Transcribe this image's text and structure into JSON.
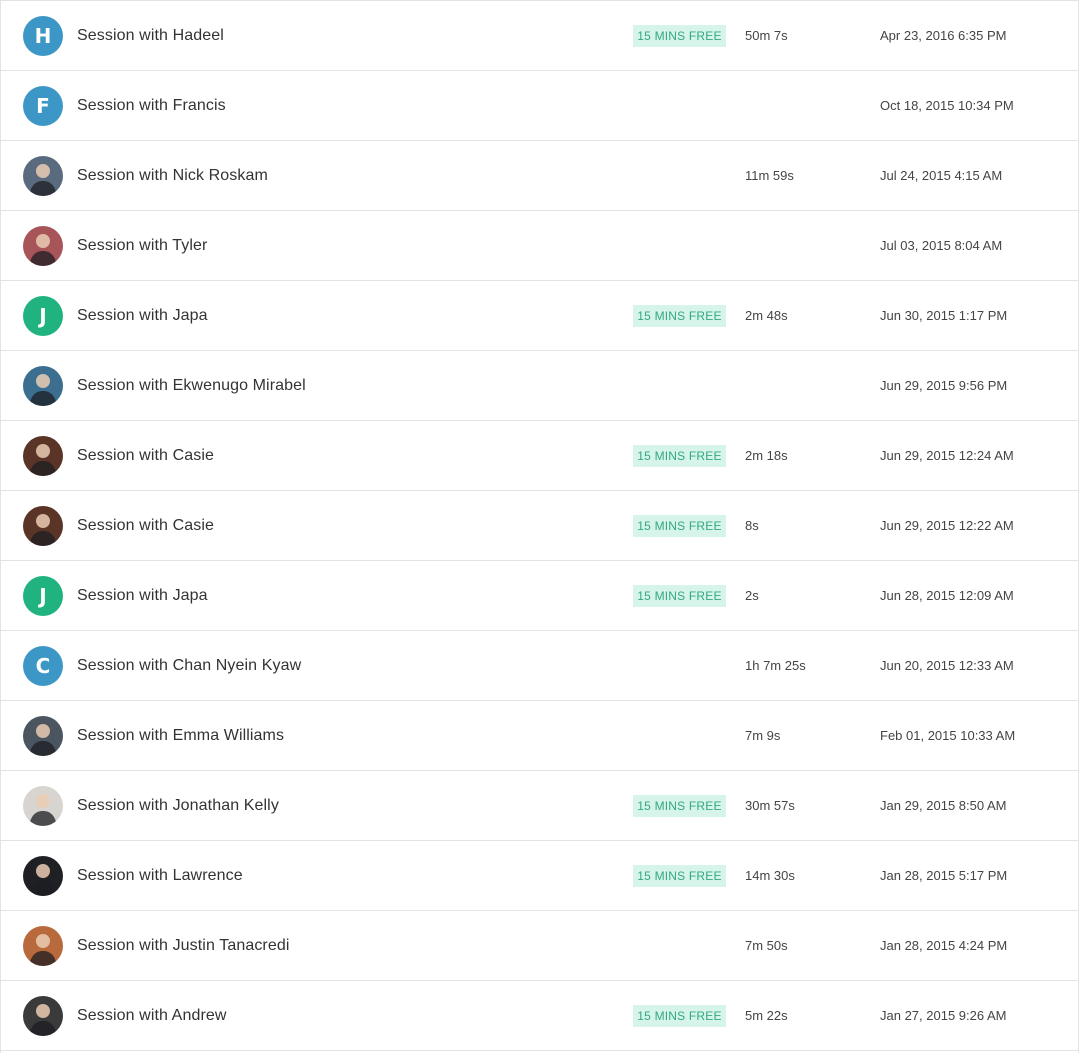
{
  "sessions": [
    {
      "avatar_type": "letter",
      "avatar_letter": "H",
      "avatar_color": "#3d97c6",
      "name": "Session with Hadeel",
      "badge": "15 MINS FREE",
      "duration": "50m 7s",
      "date": "Apr 23, 2016 6:35 PM"
    },
    {
      "avatar_type": "letter",
      "avatar_letter": "F",
      "avatar_color": "#3d97c6",
      "name": "Session with Francis",
      "badge": "",
      "duration": "",
      "date": "Oct 18, 2015 10:34 PM"
    },
    {
      "avatar_type": "photo",
      "avatar_letter": "",
      "avatar_color": "#5a6b80",
      "name": "Session with Nick Roskam",
      "badge": "",
      "duration": "11m 59s",
      "date": "Jul 24, 2015 4:15 AM"
    },
    {
      "avatar_type": "photo",
      "avatar_letter": "",
      "avatar_color": "#a8555a",
      "name": "Session with Tyler",
      "badge": "",
      "duration": "",
      "date": "Jul 03, 2015 8:04 AM"
    },
    {
      "avatar_type": "letter",
      "avatar_letter": "J",
      "avatar_color": "#21b37f",
      "name": "Session with Japa",
      "badge": "15 MINS FREE",
      "duration": "2m 48s",
      "date": "Jun 30, 2015 1:17 PM"
    },
    {
      "avatar_type": "photo",
      "avatar_letter": "",
      "avatar_color": "#3b6e8f",
      "name": "Session with Ekwenugo Mirabel",
      "badge": "",
      "duration": "",
      "date": "Jun 29, 2015 9:56 PM"
    },
    {
      "avatar_type": "photo",
      "avatar_letter": "",
      "avatar_color": "#5a3426",
      "name": "Session with Casie",
      "badge": "15 MINS FREE",
      "duration": "2m 18s",
      "date": "Jun 29, 2015 12:24 AM"
    },
    {
      "avatar_type": "photo",
      "avatar_letter": "",
      "avatar_color": "#5a3426",
      "name": "Session with Casie",
      "badge": "15 MINS FREE",
      "duration": "8s",
      "date": "Jun 29, 2015 12:22 AM"
    },
    {
      "avatar_type": "letter",
      "avatar_letter": "J",
      "avatar_color": "#21b37f",
      "name": "Session with Japa",
      "badge": "15 MINS FREE",
      "duration": "2s",
      "date": "Jun 28, 2015 12:09 AM"
    },
    {
      "avatar_type": "letter",
      "avatar_letter": "C",
      "avatar_color": "#3d97c6",
      "name": "Session with Chan Nyein Kyaw",
      "badge": "",
      "duration": "1h 7m 25s",
      "date": "Jun 20, 2015 12:33 AM"
    },
    {
      "avatar_type": "photo",
      "avatar_letter": "",
      "avatar_color": "#4a5560",
      "name": "Session with Emma Williams",
      "badge": "",
      "duration": "7m 9s",
      "date": "Feb 01, 2015 10:33 AM"
    },
    {
      "avatar_type": "photo",
      "avatar_letter": "",
      "avatar_color": "#d8d4cf",
      "name": "Session with Jonathan Kelly",
      "badge": "15 MINS FREE",
      "duration": "30m 57s",
      "date": "Jan 29, 2015 8:50 AM"
    },
    {
      "avatar_type": "photo",
      "avatar_letter": "",
      "avatar_color": "#1e2024",
      "name": "Session with Lawrence",
      "badge": "15 MINS FREE",
      "duration": "14m 30s",
      "date": "Jan 28, 2015 5:17 PM"
    },
    {
      "avatar_type": "photo",
      "avatar_letter": "",
      "avatar_color": "#b86a3c",
      "name": "Session with Justin Tanacredi",
      "badge": "",
      "duration": "7m 50s",
      "date": "Jan 28, 2015 4:24 PM"
    },
    {
      "avatar_type": "photo",
      "avatar_letter": "",
      "avatar_color": "#3a3a3a",
      "name": "Session with Andrew",
      "badge": "15 MINS FREE",
      "duration": "5m 22s",
      "date": "Jan 27, 2015 9:26 AM"
    }
  ]
}
